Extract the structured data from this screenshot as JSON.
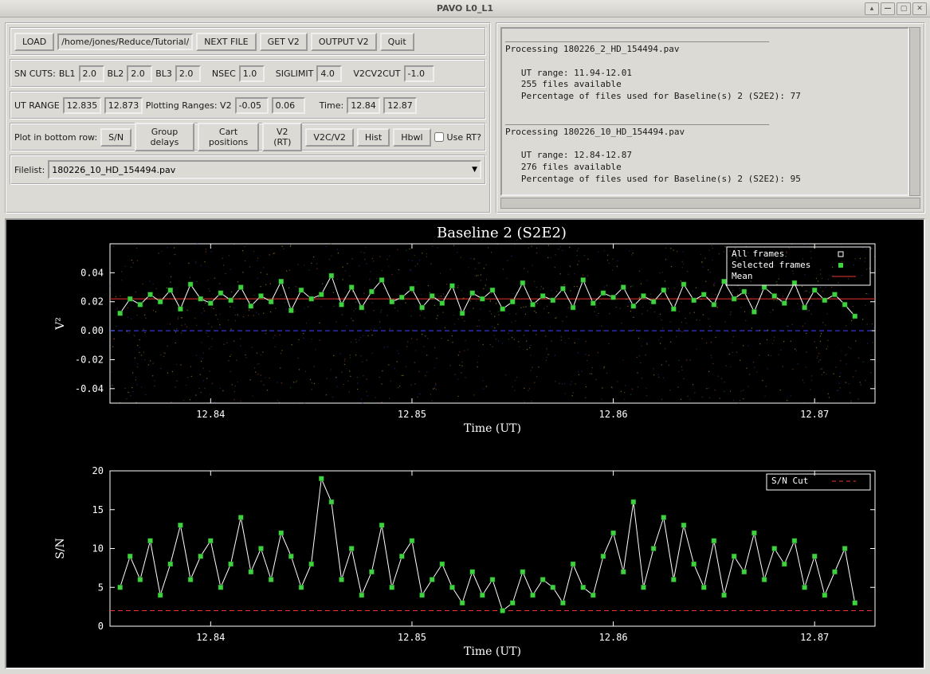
{
  "window": {
    "title": "PAVO L0_L1"
  },
  "toolbar": {
    "load": "LOAD",
    "path": "/home/jones/Reduce/Tutorial/H",
    "next_file": "NEXT FILE",
    "get_v2": "GET V2",
    "output_v2": "OUTPUT V2",
    "quit": "Quit"
  },
  "sncuts": {
    "label": "SN CUTS:",
    "bl1_lbl": "BL1",
    "bl1": "2.0",
    "bl2_lbl": "BL2",
    "bl2": "2.0",
    "bl3_lbl": "BL3",
    "bl3": "2.0",
    "nsec_lbl": "NSEC",
    "nsec": "1.0",
    "siglimit_lbl": "SIGLIMIT",
    "siglimit": "4.0",
    "v2cv2cut_lbl": "V2CV2CUT",
    "v2cv2cut": "-1.0"
  },
  "utrange": {
    "label": "UT RANGE",
    "lo": "12.835",
    "hi": "12.873",
    "plotrange_lbl": "Plotting Ranges: V2",
    "v2lo": "-0.05",
    "v2hi": "0.06",
    "time_lbl": "Time:",
    "tlo": "12.84",
    "thi": "12.87"
  },
  "bottomrow": {
    "label": "Plot in bottom row:",
    "sn": "S/N",
    "group_delays": "Group delays",
    "cart_pos": "Cart positions",
    "v2rt": "V2 (RT)",
    "v2cv2": "V2C/V2",
    "hist": "Hist",
    "hbwl": "Hbwl",
    "use_rt": "Use RT?"
  },
  "filelist": {
    "label": "Filelist:",
    "value": "180226_10_HD_154494.pav"
  },
  "log": "__________________________________________________\nProcessing 180226_2_HD_154494.pav\n\n   UT range: 11.94-12.01\n   255 files available\n   Percentage of files used for Baseline(s) 2 (S2E2): 77\n\n__________________________________________________\nProcessing 180226_10_HD_154494.pav\n\n   UT range: 12.84-12.87\n   276 files available\n   Percentage of files used for Baseline(s) 2 (S2E2): 95",
  "chart_data": [
    {
      "type": "scatter-line",
      "title": "Baseline 2 (S2E2)",
      "xlabel": "Time (UT)",
      "ylabel": "V²",
      "xlim": [
        12.835,
        12.873
      ],
      "ylim": [
        -0.05,
        0.06
      ],
      "xticks": [
        12.84,
        12.85,
        12.86,
        12.87
      ],
      "yticks": [
        -0.04,
        -0.02,
        0.0,
        0.02,
        0.04
      ],
      "legend": [
        "All frames",
        "Selected frames",
        "Mean"
      ],
      "hline_red": 0.022,
      "hline_blue": 0.0,
      "series": [
        {
          "name": "Selected frames",
          "color": "#3fd13f",
          "marker": "square",
          "x": [
            12.8355,
            12.836,
            12.8365,
            12.837,
            12.8375,
            12.838,
            12.8385,
            12.839,
            12.8395,
            12.84,
            12.8405,
            12.841,
            12.8415,
            12.842,
            12.8425,
            12.843,
            12.8435,
            12.844,
            12.8445,
            12.845,
            12.8455,
            12.846,
            12.8465,
            12.847,
            12.8475,
            12.848,
            12.8485,
            12.849,
            12.8495,
            12.85,
            12.8505,
            12.851,
            12.8515,
            12.852,
            12.8525,
            12.853,
            12.8535,
            12.854,
            12.8545,
            12.855,
            12.8555,
            12.856,
            12.8565,
            12.857,
            12.8575,
            12.858,
            12.8585,
            12.859,
            12.8595,
            12.86,
            12.8605,
            12.861,
            12.8615,
            12.862,
            12.8625,
            12.863,
            12.8635,
            12.864,
            12.8645,
            12.865,
            12.8655,
            12.866,
            12.8665,
            12.867,
            12.8675,
            12.868,
            12.8685,
            12.869,
            12.8695,
            12.87,
            12.8705,
            12.871,
            12.8715,
            12.872
          ],
          "y": [
            0.012,
            0.022,
            0.018,
            0.025,
            0.02,
            0.028,
            0.015,
            0.032,
            0.022,
            0.019,
            0.026,
            0.021,
            0.03,
            0.017,
            0.024,
            0.02,
            0.034,
            0.014,
            0.028,
            0.022,
            0.025,
            0.038,
            0.018,
            0.03,
            0.016,
            0.027,
            0.035,
            0.02,
            0.023,
            0.029,
            0.016,
            0.024,
            0.019,
            0.031,
            0.012,
            0.026,
            0.022,
            0.028,
            0.015,
            0.02,
            0.033,
            0.018,
            0.024,
            0.021,
            0.029,
            0.016,
            0.035,
            0.019,
            0.026,
            0.023,
            0.03,
            0.017,
            0.024,
            0.02,
            0.028,
            0.015,
            0.032,
            0.021,
            0.025,
            0.018,
            0.034,
            0.022,
            0.027,
            0.013,
            0.03,
            0.024,
            0.019,
            0.033,
            0.016,
            0.028,
            0.021,
            0.025,
            0.018,
            0.01
          ]
        }
      ]
    },
    {
      "type": "scatter-line",
      "title": "",
      "xlabel": "Time (UT)",
      "ylabel": "S/N",
      "xlim": [
        12.835,
        12.873
      ],
      "ylim": [
        0,
        20
      ],
      "xticks": [
        12.84,
        12.85,
        12.86,
        12.87
      ],
      "yticks": [
        0,
        5,
        10,
        15,
        20
      ],
      "legend": [
        "S/N Cut"
      ],
      "hline_red": 2.0,
      "series": [
        {
          "name": "S/N",
          "color": "#3fd13f",
          "marker": "square",
          "x": [
            12.8355,
            12.836,
            12.8365,
            12.837,
            12.8375,
            12.838,
            12.8385,
            12.839,
            12.8395,
            12.84,
            12.8405,
            12.841,
            12.8415,
            12.842,
            12.8425,
            12.843,
            12.8435,
            12.844,
            12.8445,
            12.845,
            12.8455,
            12.846,
            12.8465,
            12.847,
            12.8475,
            12.848,
            12.8485,
            12.849,
            12.8495,
            12.85,
            12.8505,
            12.851,
            12.8515,
            12.852,
            12.8525,
            12.853,
            12.8535,
            12.854,
            12.8545,
            12.855,
            12.8555,
            12.856,
            12.8565,
            12.857,
            12.8575,
            12.858,
            12.8585,
            12.859,
            12.8595,
            12.86,
            12.8605,
            12.861,
            12.8615,
            12.862,
            12.8625,
            12.863,
            12.8635,
            12.864,
            12.8645,
            12.865,
            12.8655,
            12.866,
            12.8665,
            12.867,
            12.8675,
            12.868,
            12.8685,
            12.869,
            12.8695,
            12.87,
            12.8705,
            12.871,
            12.8715,
            12.872
          ],
          "y": [
            5,
            9,
            6,
            11,
            4,
            8,
            13,
            6,
            9,
            11,
            5,
            8,
            14,
            7,
            10,
            6,
            12,
            9,
            5,
            8,
            19,
            16,
            6,
            10,
            4,
            7,
            13,
            5,
            9,
            11,
            4,
            6,
            8,
            5,
            3,
            7,
            4,
            6,
            2,
            3,
            7,
            4,
            6,
            5,
            3,
            8,
            5,
            4,
            9,
            12,
            7,
            16,
            5,
            10,
            14,
            6,
            13,
            8,
            5,
            11,
            4,
            9,
            7,
            12,
            6,
            10,
            8,
            11,
            5,
            9,
            4,
            7,
            10,
            3
          ]
        }
      ]
    }
  ]
}
